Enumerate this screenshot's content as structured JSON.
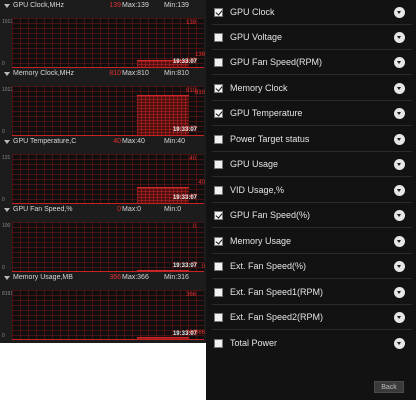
{
  "monitor": {
    "graphs": [
      {
        "name": "GPU Clock,MHz",
        "current": "139",
        "max": "Max:139",
        "min": "Min:139",
        "axis_top": "1012",
        "axis_bottom": "0",
        "plot_top": "139",
        "plot_bottom": "139",
        "time": "19:33:07",
        "right_value": "139",
        "fill_level": 0.14
      },
      {
        "name": "Memory Clock,MHz",
        "current": "810",
        "max": "Max:810",
        "min": "Min:810",
        "axis_top": "1012",
        "axis_bottom": "0",
        "plot_top": "810",
        "plot_bottom": "810",
        "time": "19:33:07",
        "right_value": "810",
        "fill_level": 0.8
      },
      {
        "name": "GPU Temperature,C",
        "current": "40",
        "max": "Max:40",
        "min": "Min:40",
        "axis_top": "131",
        "axis_bottom": "0",
        "plot_top": "40",
        "plot_bottom": "40",
        "time": "19:33:07",
        "right_value": "40",
        "fill_level": 0.31
      },
      {
        "name": "GPU Fan Speed,%",
        "current": "0",
        "max": "Max:0",
        "min": "Min:0",
        "axis_top": "100",
        "axis_bottom": "0",
        "plot_top": "0",
        "plot_bottom": "0",
        "time": "19:33:07",
        "right_value": "0",
        "fill_level": 0
      },
      {
        "name": "Memory Usage,MB",
        "current": "366",
        "max": "Max:366",
        "min": "Min:316",
        "axis_top": "8191",
        "axis_bottom": "0",
        "plot_top": "366",
        "plot_bottom": "366",
        "time": "19:33:07",
        "right_value": "366",
        "fill_level": 0.045
      }
    ]
  },
  "settings": {
    "items": [
      {
        "label": "GPU Clock",
        "checked": true
      },
      {
        "label": "GPU Voltage",
        "checked": false
      },
      {
        "label": "GPU Fan Speed(RPM)",
        "checked": false
      },
      {
        "label": "Memory Clock",
        "checked": true
      },
      {
        "label": "GPU Temperature",
        "checked": true
      },
      {
        "label": "Power Target status",
        "checked": false
      },
      {
        "label": "GPU Usage",
        "checked": false
      },
      {
        "label": "VID Usage,%",
        "checked": false
      },
      {
        "label": "GPU Fan Speed(%)",
        "checked": true
      },
      {
        "label": "Memory Usage",
        "checked": true
      },
      {
        "label": "Ext. Fan Speed(%)",
        "checked": false
      },
      {
        "label": "Ext. Fan Speed1(RPM)",
        "checked": false
      },
      {
        "label": "Ext. Fan Speed2(RPM)",
        "checked": false
      },
      {
        "label": "Total Power",
        "checked": false
      }
    ],
    "back_label": "Back"
  },
  "colors": {
    "accent_red": "#e23030",
    "panel_bg": "#1c1c1c",
    "settings_bg": "#121212"
  }
}
